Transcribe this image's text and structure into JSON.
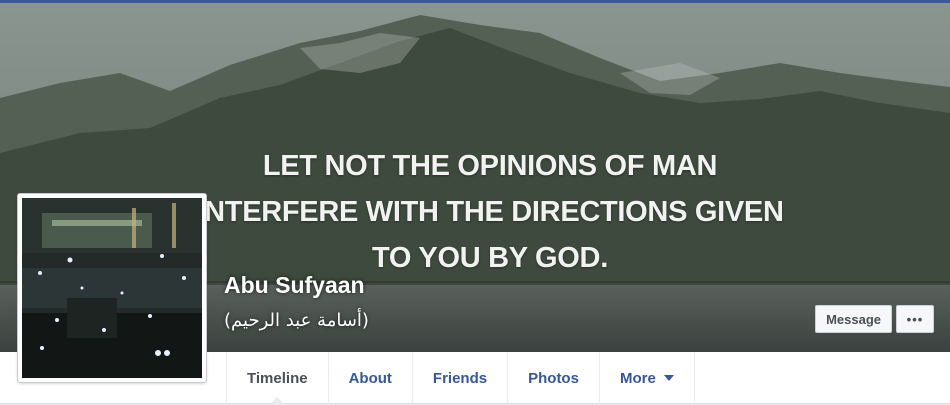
{
  "cover": {
    "quote_lines": [
      "LET NOT THE OPINIONS OF MAN",
      "INTERFERE WITH THE DIRECTIONS GIVEN",
      "TO YOU BY GOD."
    ]
  },
  "profile": {
    "name": "Abu Sufyaan",
    "alternate_name": "(أسامة عبد الرحيم)"
  },
  "actions": {
    "message_label": "Message",
    "more_label": "•••"
  },
  "tabs": [
    {
      "label": "Timeline",
      "active": true
    },
    {
      "label": "About",
      "active": false
    },
    {
      "label": "Friends",
      "active": false
    },
    {
      "label": "Photos",
      "active": false
    },
    {
      "label": "More",
      "active": false,
      "has_dropdown": true
    }
  ],
  "colors": {
    "brand": "#3b5998",
    "link": "#365899",
    "tab_active": "#4b4f56"
  },
  "icons": {
    "more_dropdown": "caret-down-icon",
    "options": "ellipsis-icon"
  }
}
